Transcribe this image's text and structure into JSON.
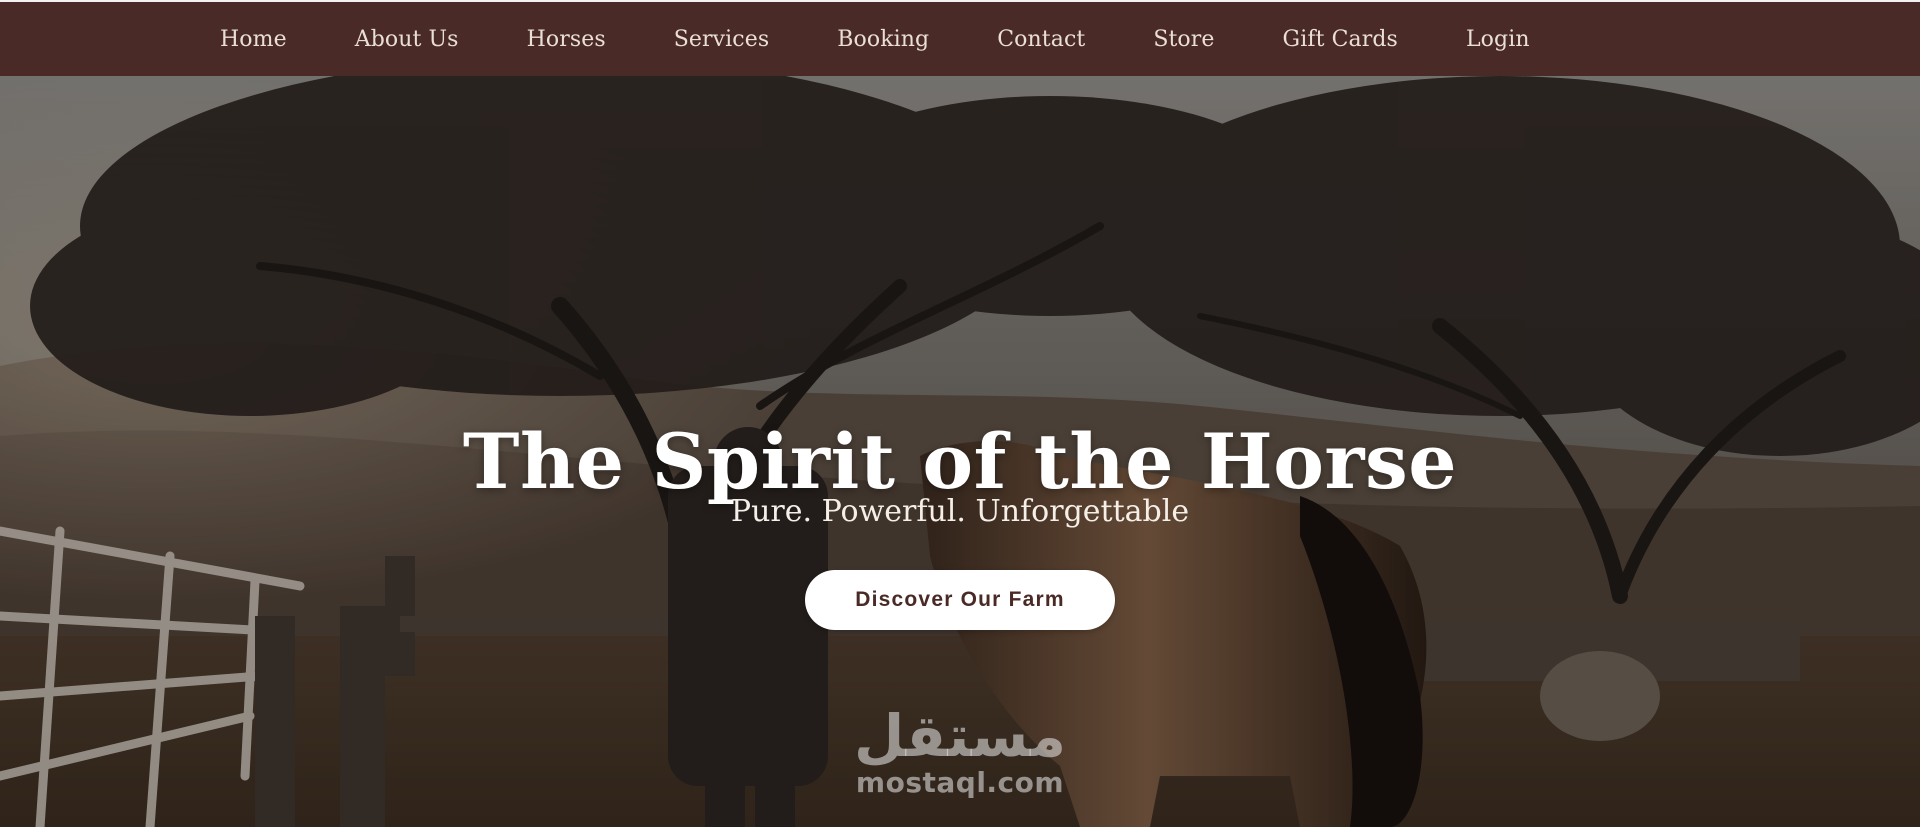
{
  "nav": {
    "items": [
      {
        "label": "Home"
      },
      {
        "label": "About Us"
      },
      {
        "label": "Horses"
      },
      {
        "label": "Services"
      },
      {
        "label": "Booking"
      },
      {
        "label": "Contact"
      },
      {
        "label": "Store"
      },
      {
        "label": "Gift Cards"
      },
      {
        "label": "Login"
      }
    ]
  },
  "hero": {
    "title": "The Spirit of the Horse",
    "subtitle": "Pure. Powerful. Unforgettable",
    "cta_label": "Discover Our Farm"
  },
  "watermark": {
    "arabic": "مستقل",
    "latin": "mostaql.com"
  },
  "colors": {
    "nav_background": "#4a2a26",
    "nav_text": "#eadfd6",
    "cta_background": "#ffffff",
    "cta_text": "#4a2a26",
    "title_text": "#ffffff"
  }
}
